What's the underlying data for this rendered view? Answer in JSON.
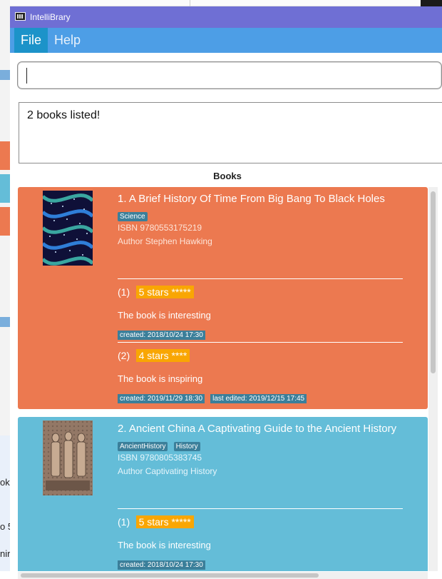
{
  "window": {
    "title": "IntelliBrary"
  },
  "menu": {
    "items": [
      "File",
      "Help"
    ]
  },
  "command_box": {
    "value": "",
    "placeholder": ""
  },
  "result": {
    "message": "2 books listed!"
  },
  "list": {
    "title": "Books",
    "books": [
      {
        "title": "1.  A Brief History Of Time From Big Bang To Black Holes",
        "tags": [
          "Science"
        ],
        "isbn": "ISBN 9780553175219",
        "author": "Author Stephen Hawking",
        "reviews": [
          {
            "index": "(1)",
            "stars": "5 stars *****",
            "rating": 5,
            "text": "The book is interesting",
            "stamps": [
              "created: 2018/10/24 17:30"
            ]
          },
          {
            "index": "(2)",
            "stars": "4 stars ****",
            "rating": 4,
            "text": "The book is inspiring",
            "stamps": [
              "created: 2019/11/29 18:30",
              "last edited: 2019/12/15 17:45"
            ]
          }
        ]
      },
      {
        "title": "2.  Ancient China A Captivating Guide to the Ancient History",
        "tags": [
          "AncientHistory",
          "History"
        ],
        "isbn": "ISBN 9780805383745",
        "author": "Author Captivating History",
        "reviews": [
          {
            "index": "(1)",
            "stars": "5 stars *****",
            "rating": 5,
            "text": "The book is interesting",
            "stamps": [
              "created: 2018/10/24 17:30"
            ]
          }
        ]
      }
    ]
  },
  "background": {
    "fragments": [
      "ok",
      "o 5",
      "nir"
    ]
  },
  "colors": {
    "titlebar": "#6f6fd4",
    "menubar": "#4d9ee6",
    "card1": "#ec7950",
    "card2": "#64bdd8",
    "stars_badge": "#f9a603",
    "tag": "#3b7f9a"
  }
}
